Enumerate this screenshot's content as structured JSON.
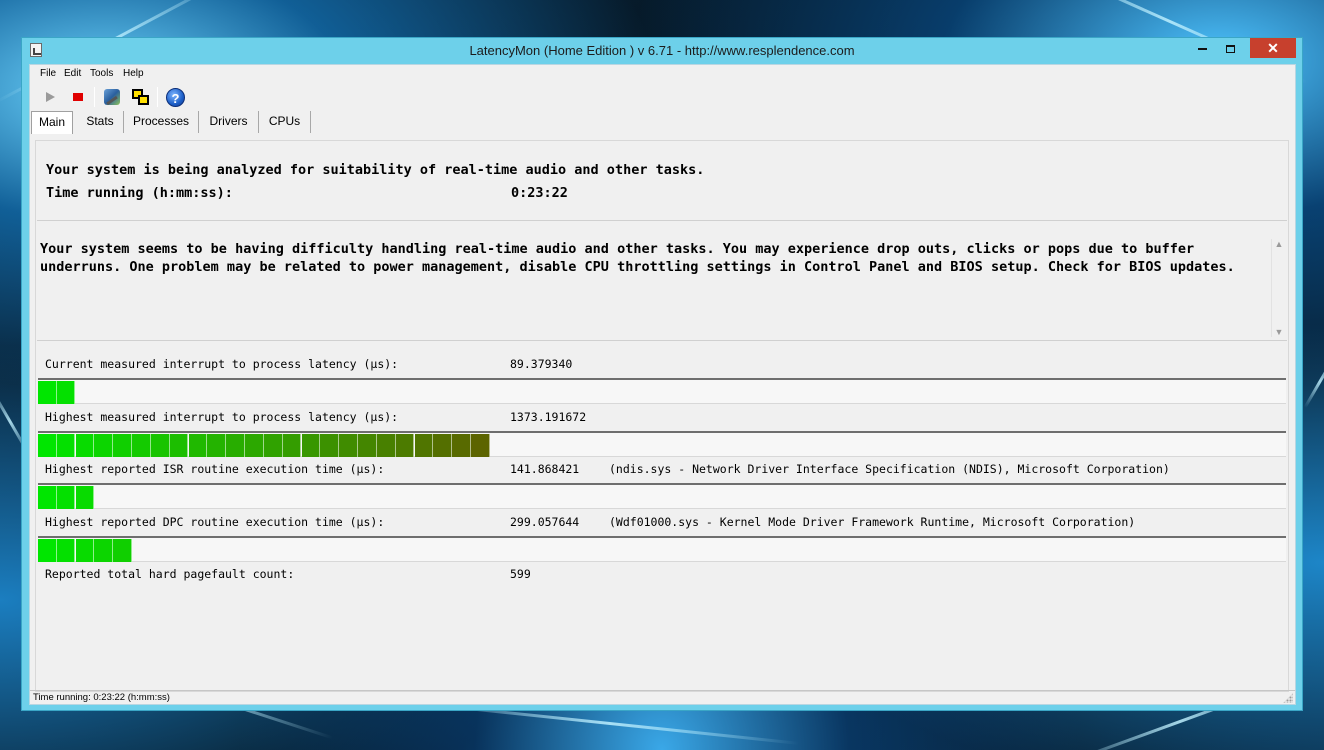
{
  "window": {
    "title": "LatencyMon  (Home Edition )  v 6.71 - http://www.resplendence.com",
    "close_glyph": "✕"
  },
  "menu": [
    {
      "label": "File"
    },
    {
      "label": "Edit"
    },
    {
      "label": "Tools"
    },
    {
      "label": "Help"
    }
  ],
  "toolbar": {
    "icons": [
      "play-icon",
      "stop-icon",
      "tools-icon",
      "windows-icon",
      "help-icon"
    ],
    "help_glyph": "?"
  },
  "tabs": [
    {
      "label": "Main",
      "active": true
    },
    {
      "label": "Stats",
      "active": false
    },
    {
      "label": "Processes",
      "active": false
    },
    {
      "label": "Drivers",
      "active": false
    },
    {
      "label": "CPUs",
      "active": false
    }
  ],
  "status": {
    "line1": "Your system is being analyzed for suitability of real-time audio and other tasks.",
    "time_label": "Time running (h:mm:ss):",
    "time_value": "0:23:22"
  },
  "message": "Your system seems to be having difficulty handling real-time audio and other tasks. You may experience drop outs, clicks or pops due to buffer underruns. One problem may be related to power management, disable CPU throttling settings in Control Panel and BIOS setup. Check for BIOS updates.",
  "metrics": [
    {
      "label": "Current measured interrupt to process latency (µs):",
      "value": "89.379340",
      "detail": "",
      "bar_segments": 2
    },
    {
      "label": "Highest measured interrupt to process latency (µs):",
      "value": "1373.191672",
      "detail": "",
      "bar_segments": 24
    },
    {
      "label": "Highest reported ISR routine execution time (µs):",
      "value": "141.868421",
      "detail": "(ndis.sys - Network Driver Interface Specification (NDIS), Microsoft Corporation)",
      "bar_segments": 3
    },
    {
      "label": "Highest reported DPC routine execution time (µs):",
      "value": "299.057644",
      "detail": "(Wdf01000.sys - Kernel Mode Driver Framework Runtime, Microsoft Corporation)",
      "bar_segments": 5
    },
    {
      "label": "Reported total hard pagefault count:",
      "value": "599",
      "detail": ""
    }
  ],
  "statusbar": {
    "text": "Time running: 0:23:22  (h:mm:ss)"
  },
  "colors": {
    "bar_green": "#00e600",
    "bar_olive": "#5c6400",
    "window_frame": "#6dd0ea",
    "close_red": "#c7402d"
  }
}
